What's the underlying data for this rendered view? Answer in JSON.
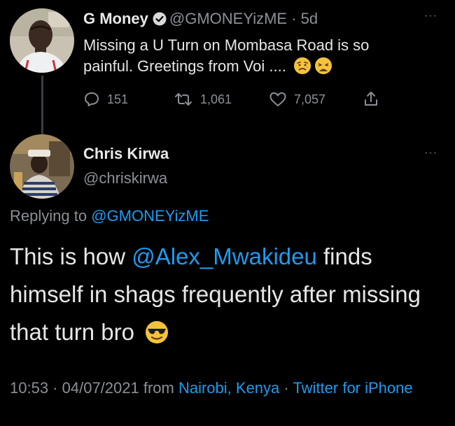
{
  "tweet1": {
    "display_name": "G Money",
    "handle": "@GMONEYizME",
    "sep": " · ",
    "age": "5d",
    "text": "Missing a U Turn on Mombasa Road is so painful. Greetings from Voi ....",
    "emojis": [
      "sad-relieved-face",
      "weary-face"
    ],
    "replies": "151",
    "retweets": "1,061",
    "likes": "7,057"
  },
  "tweet2": {
    "display_name": "Chris Kirwa",
    "handle": "@chriskirwa",
    "replying_prefix": "Replying to ",
    "replying_handle": "@GMONEYizME",
    "text_pre": "This is how ",
    "mention": "@Alex_Mwakideu",
    "text_post": " finds himself in shags frequently after missing that turn bro",
    "emoji": "smiling-face-with-sunglasses",
    "time": "10:53",
    "date_sep": " · ",
    "date": "04/07/2021",
    "from": " from ",
    "location": "Nairobi, Kenya",
    "source_sep": " · ",
    "source": "Twitter for iPhone"
  },
  "more_label": "···",
  "colors": {
    "link": "#1d9bf0",
    "muted": "#8b9096",
    "text": "#e6e6e6",
    "background": "#000000"
  }
}
